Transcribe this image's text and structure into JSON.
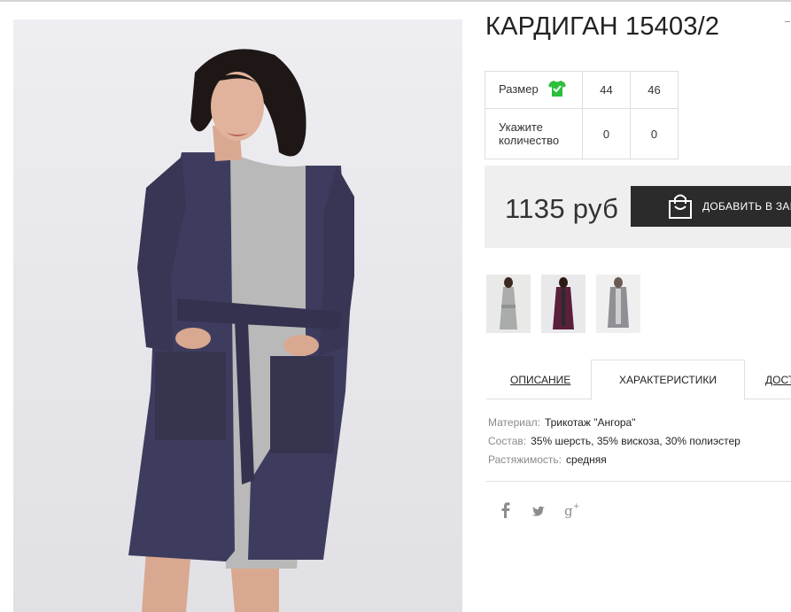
{
  "product": {
    "title": "КАРДИГАН 15403/2"
  },
  "sizes": {
    "size_label": "Размер",
    "quantity_label": "Укажите количество",
    "columns": [
      "44",
      "46"
    ],
    "quantities": [
      "0",
      "0"
    ]
  },
  "purchase": {
    "price": "1135 руб",
    "cart_button_label": "ДОБАВИТЬ В ЗАКАЗ"
  },
  "tabs": {
    "description": "ОПИСАНИЕ",
    "characteristics": "ХАРАКТЕРИСТИКИ",
    "delivery": "ДОСТ"
  },
  "characteristics": [
    {
      "key": "Материал:",
      "value": "Трикотаж \"Ангора\""
    },
    {
      "key": "Состав:",
      "value": "35% шерсть, 35% вискоза, 30% полиэстер"
    },
    {
      "key": "Растяжимость:",
      "value": "средняя"
    }
  ],
  "social": [
    "facebook-icon",
    "twitter-icon",
    "google-plus-icon"
  ],
  "colors": {
    "button_bg": "#2b2b2b",
    "price_panel_bg": "#efefef",
    "size_ok_green": "#2bbf3c",
    "cardigan_navy": "#3e3c5e"
  }
}
